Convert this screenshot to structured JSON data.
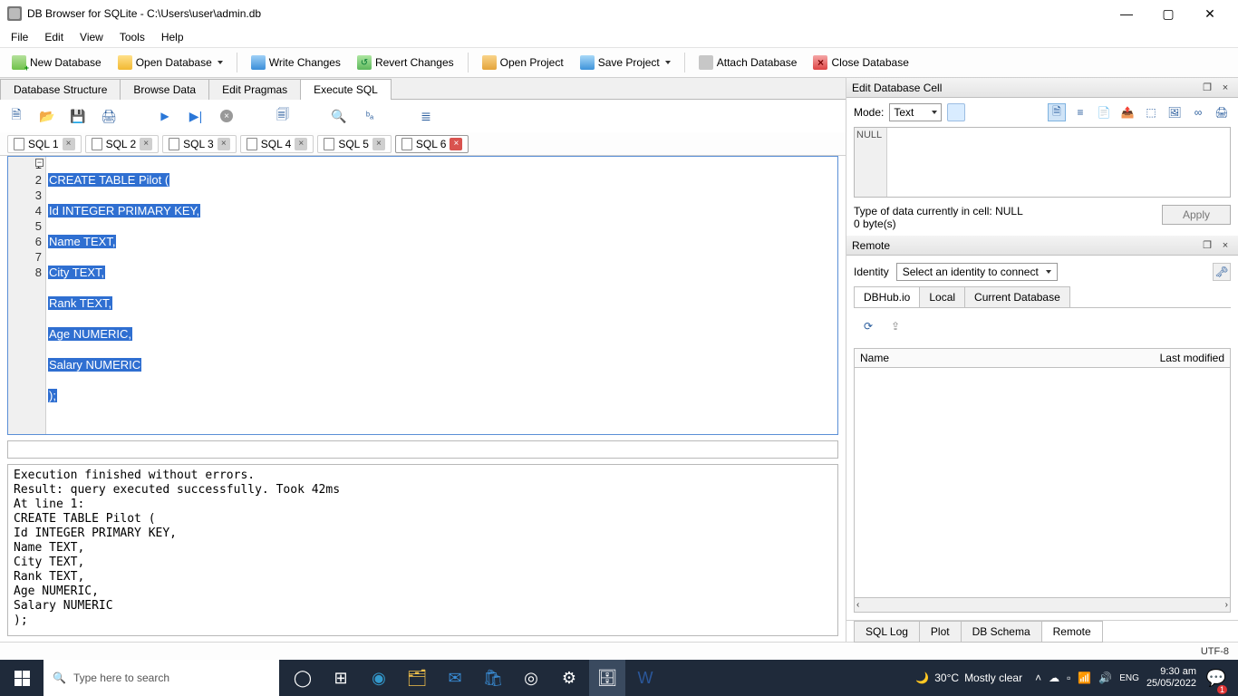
{
  "window": {
    "title": "DB Browser for SQLite - C:\\Users\\user\\admin.db"
  },
  "menu": [
    "File",
    "Edit",
    "View",
    "Tools",
    "Help"
  ],
  "toolbar": {
    "new_db": "New Database",
    "open_db": "Open Database",
    "write": "Write Changes",
    "revert": "Revert Changes",
    "open_proj": "Open Project",
    "save_proj": "Save Project",
    "attach": "Attach Database",
    "close": "Close Database"
  },
  "plane_tabs": [
    "Database Structure",
    "Browse Data",
    "Edit Pragmas",
    "Execute SQL"
  ],
  "plane_active": 3,
  "sql_tabs": [
    "SQL 1",
    "SQL 2",
    "SQL 3",
    "SQL 4",
    "SQL 5",
    "SQL 6"
  ],
  "sql_active": 5,
  "editor": {
    "lines": [
      "CREATE TABLE Pilot (",
      "Id INTEGER PRIMARY KEY,",
      "Name TEXT,",
      "City TEXT,",
      "Rank TEXT,",
      "Age NUMERIC,",
      "Salary NUMERIC",
      ");"
    ]
  },
  "log": "Execution finished without errors.\nResult: query executed successfully. Took 42ms\nAt line 1:\nCREATE TABLE Pilot (\nId INTEGER PRIMARY KEY,\nName TEXT,\nCity TEXT,\nRank TEXT,\nAge NUMERIC,\nSalary NUMERIC\n);",
  "cell_panel": {
    "title": "Edit Database Cell",
    "mode_label": "Mode:",
    "mode_value": "Text",
    "null": "NULL",
    "type_text": "Type of data currently in cell: NULL",
    "size_text": "0 byte(s)",
    "apply": "Apply"
  },
  "remote_panel": {
    "title": "Remote",
    "identity_label": "Identity",
    "identity_value": "Select an identity to connect",
    "tabs": [
      "DBHub.io",
      "Local",
      "Current Database"
    ],
    "tab_active": 0,
    "cols": {
      "name": "Name",
      "last": "Last modified"
    }
  },
  "bottom_tabs": [
    "SQL Log",
    "Plot",
    "DB Schema",
    "Remote"
  ],
  "bottom_active": 3,
  "status": {
    "encoding": "UTF-8"
  },
  "taskbar": {
    "search_placeholder": "Type here to search",
    "weather_temp": "30°C",
    "weather_text": "Mostly clear",
    "time": "9:30 am",
    "date": "25/05/2022"
  }
}
